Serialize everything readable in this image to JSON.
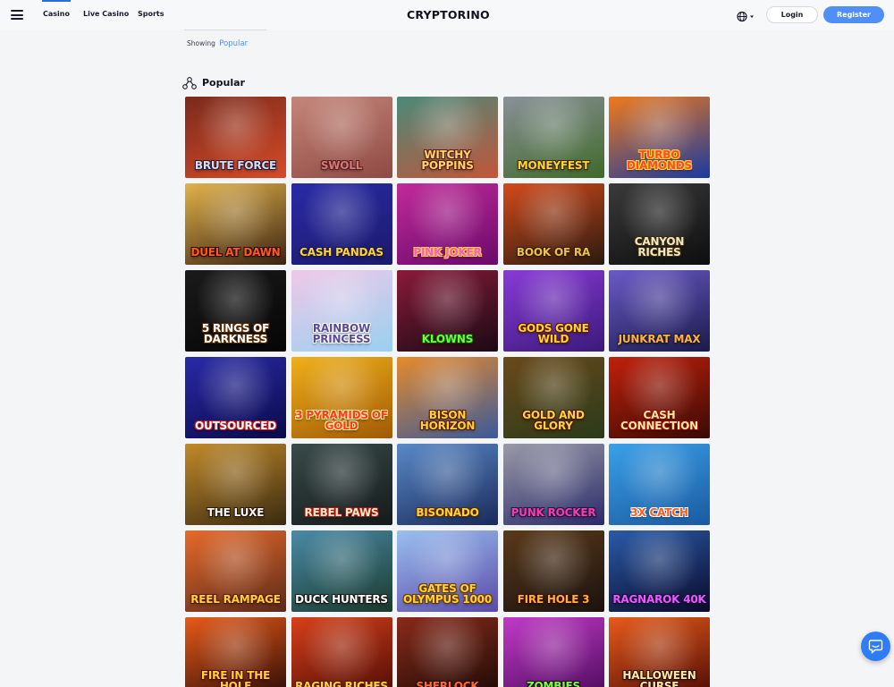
{
  "header": {
    "brand": "CRYPTORINO",
    "nav": [
      {
        "label": "Casino",
        "active": true
      },
      {
        "label": "Live Casino",
        "active": false
      },
      {
        "label": "Sports",
        "active": false
      }
    ],
    "language_icon": "globe-icon",
    "login_label": "Login",
    "register_label": "Register",
    "accent_color": "#4f8ff7"
  },
  "filter": {
    "prefix": "Showing",
    "value": "Popular"
  },
  "section": {
    "title": "Popular",
    "icon": "category-icon"
  },
  "games": [
    {
      "title": "Brute Force",
      "bg1": "#7a2a1c",
      "bg2": "#d64b28",
      "color": "#d9dde8",
      "stroke": "#2a1a3a"
    },
    {
      "title": "Swoll",
      "bg1": "#c5867a",
      "bg2": "#8e4a44",
      "color": "#d17a78",
      "stroke": "#5a1f22"
    },
    {
      "title": "Witchy Poppins",
      "bg1": "#4a8a7a",
      "bg2": "#c2563a",
      "color": "#ffd46a",
      "stroke": "#5a1f12"
    },
    {
      "title": "Moneyfest",
      "bg1": "#8a9098",
      "bg2": "#3f6a2a",
      "color": "#ffd23a",
      "stroke": "#3a2a08"
    },
    {
      "title": "Turbo Diamonds",
      "bg1": "#f07a1a",
      "bg2": "#1a3aa0",
      "color": "#ff4a2a",
      "stroke": "#ffd23a"
    },
    {
      "title": "Duel at Dawn",
      "bg1": "#e2b24a",
      "bg2": "#3a2412",
      "color": "#ff5a1a",
      "stroke": "#2a0a05"
    },
    {
      "title": "Cash Pandas",
      "bg1": "#2a2aa8",
      "bg2": "#1a1a6a",
      "color": "#ffd23a",
      "stroke": "#1a1a4a"
    },
    {
      "title": "Pink Joker",
      "bg1": "#c22a9a",
      "bg2": "#6a0a6a",
      "color": "#ff5ac8",
      "stroke": "#ffd23a"
    },
    {
      "title": "Book of Ra",
      "bg1": "#d44a1a",
      "bg2": "#2a1a10",
      "color": "#e8c24a",
      "stroke": "#3a1a05"
    },
    {
      "title": "Canyon Riches",
      "bg1": "#3a3a3a",
      "bg2": "#0e0e0e",
      "color": "#f4e9c2",
      "stroke": "#3a2a10"
    },
    {
      "title": "5 Rings of Darkness",
      "bg1": "#1a1a1a",
      "bg2": "#050505",
      "color": "#ffffff",
      "stroke": "#5a2a00"
    },
    {
      "title": "Rainbow Princess",
      "bg1": "#f0c8e8",
      "bg2": "#9ad0f0",
      "color": "#5a4a9a",
      "stroke": "#ffffff"
    },
    {
      "title": "Klowns",
      "bg1": "#8a1a3a",
      "bg2": "#1a0a14",
      "color": "#6aff3a",
      "stroke": "#1a4a05"
    },
    {
      "title": "Gods Gone Wild",
      "bg1": "#8a3ad8",
      "bg2": "#3a1a7a",
      "color": "#ffd23a",
      "stroke": "#5a1a00"
    },
    {
      "title": "Junkrat Max",
      "bg1": "#6a5ac8",
      "bg2": "#1a1a4a",
      "color": "#ffb23a",
      "stroke": "#1a1a3a"
    },
    {
      "title": "Outsourced",
      "bg1": "#2a2aa8",
      "bg2": "#0a0a4a",
      "color": "#ffffff",
      "stroke": "#c21a1a"
    },
    {
      "title": "3 Pyramids of Gold",
      "bg1": "#f0b01a",
      "bg2": "#a05a05",
      "color": "#ff3a1a",
      "stroke": "#ffe9a0"
    },
    {
      "title": "Bison Horizon",
      "bg1": "#e88a2a",
      "bg2": "#3a5a9a",
      "color": "#ffd23a",
      "stroke": "#5a1a00"
    },
    {
      "title": "Gold and Glory",
      "bg1": "#6a4a1a",
      "bg2": "#2a3a1a",
      "color": "#ffd23a",
      "stroke": "#4a1a00"
    },
    {
      "title": "Cash Connection",
      "bg1": "#c2200a",
      "bg2": "#3a0a05",
      "color": "#ffe9a0",
      "stroke": "#8a0a05"
    },
    {
      "title": "The Luxe",
      "bg1": "#c28a2a",
      "bg2": "#3a2a10",
      "color": "#f4f4f4",
      "stroke": "#2a1a05"
    },
    {
      "title": "Rebel Paws",
      "bg1": "#3a4a4a",
      "bg2": "#141a1a",
      "color": "#ffe9c2",
      "stroke": "#a01a1a"
    },
    {
      "title": "Bisonado",
      "bg1": "#5a8ac8",
      "bg2": "#1a2a5a",
      "color": "#ffd23a",
      "stroke": "#5a2a00"
    },
    {
      "title": "Punk Rocker",
      "bg1": "#9a9aa8",
      "bg2": "#2a2a6a",
      "color": "#ff3aa8",
      "stroke": "#1a1a4a"
    },
    {
      "title": "3x Catch",
      "bg1": "#3aa0e8",
      "bg2": "#1a5aa0",
      "color": "#ff5a1a",
      "stroke": "#ffffff"
    },
    {
      "title": "Reel Rampage",
      "bg1": "#e86a2a",
      "bg2": "#5a2a1a",
      "color": "#ffd23a",
      "stroke": "#5a1a00"
    },
    {
      "title": "Duck Hunters",
      "bg1": "#4a8aa8",
      "bg2": "#1a3a2a",
      "color": "#ffffff",
      "stroke": "#1a1a1a"
    },
    {
      "title": "Gates of Olympus 1000",
      "bg1": "#9ac0f0",
      "bg2": "#5a4aa8",
      "color": "#ffd23a",
      "stroke": "#6a3a00"
    },
    {
      "title": "Fire Hole 3",
      "bg1": "#5a3a1a",
      "bg2": "#1a1210",
      "color": "#ffb23a",
      "stroke": "#3a0a00"
    },
    {
      "title": "Ragnarok 40K",
      "bg1": "#2a5aa8",
      "bg2": "#0a0a2a",
      "color": "#e85aff",
      "stroke": "#1a0a3a"
    },
    {
      "title": "Fire in the Hole",
      "bg1": "#e85a1a",
      "bg2": "#2a0a05",
      "color": "#ffd23a",
      "stroke": "#5a0a00"
    },
    {
      "title": "Raging Riches",
      "bg1": "#d8401a",
      "bg2": "#4a0a05",
      "color": "#ffd23a",
      "stroke": "#5a1a00"
    },
    {
      "title": "Sherlock",
      "bg1": "#8a2a1a",
      "bg2": "#1a0a05",
      "color": "#ff6a2a",
      "stroke": "#2a0a05"
    },
    {
      "title": "Zombies",
      "bg1": "#c23ac8",
      "bg2": "#4a0a5a",
      "color": "#7aff3a",
      "stroke": "#1a0a1a"
    },
    {
      "title": "Halloween Curse",
      "bg1": "#e85a1a",
      "bg2": "#4a0a05",
      "color": "#ffe9a0",
      "stroke": "#2a0a05"
    }
  ],
  "chat": {
    "icon": "chat-bubble-icon"
  }
}
